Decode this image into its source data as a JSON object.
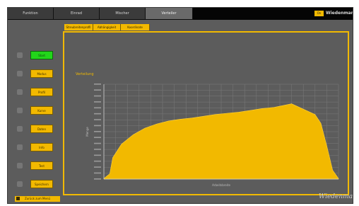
{
  "tabs": [
    "Funktion",
    "Einrad",
    "Mischer",
    "Verteiler"
  ],
  "active_tab": 3,
  "top_badge": "On",
  "top_logo": "Wiedenmann",
  "side_buttons": [
    "Start",
    "Modus",
    "Profil",
    "Kurve",
    "Daten",
    "Info",
    "Test",
    "Speichern"
  ],
  "active_side_button": 0,
  "sub_tabs": [
    "Streubreitenprofil",
    "Abhängigkeit",
    "Koordinate"
  ],
  "bottom_button": "Zurück zum Menü",
  "signature": "Wiedenmann",
  "chart_data": {
    "type": "area",
    "title": "Verteilung",
    "xlabel": "Arbeitsbreite",
    "ylabel": "Menge",
    "ylim": [
      0,
      16
    ],
    "grid": true,
    "x_tick_count": 21,
    "points": [
      [
        0,
        0.1
      ],
      [
        1,
        0.9
      ],
      [
        1.5,
        3.6
      ],
      [
        3,
        5.9
      ],
      [
        5,
        7.5
      ],
      [
        7,
        8.6
      ],
      [
        9,
        9.3
      ],
      [
        11,
        9.8
      ],
      [
        13,
        10.1
      ],
      [
        15,
        10.3
      ],
      [
        17,
        10.6
      ],
      [
        19,
        10.9
      ],
      [
        21,
        11.1
      ],
      [
        23,
        11.3
      ],
      [
        25,
        11.6
      ],
      [
        27,
        11.9
      ],
      [
        29,
        12.1
      ],
      [
        31,
        12.5
      ],
      [
        32,
        12.7
      ],
      [
        34,
        11.8
      ],
      [
        36,
        10.9
      ],
      [
        37,
        9.4
      ],
      [
        38,
        5.6
      ],
      [
        39,
        1.5
      ],
      [
        40,
        0.1
      ]
    ]
  },
  "colors": {
    "accent": "#f2b900",
    "active_button": "#22d61a",
    "background": "#5c5c5c",
    "tabbar": "#0d0d0d"
  }
}
